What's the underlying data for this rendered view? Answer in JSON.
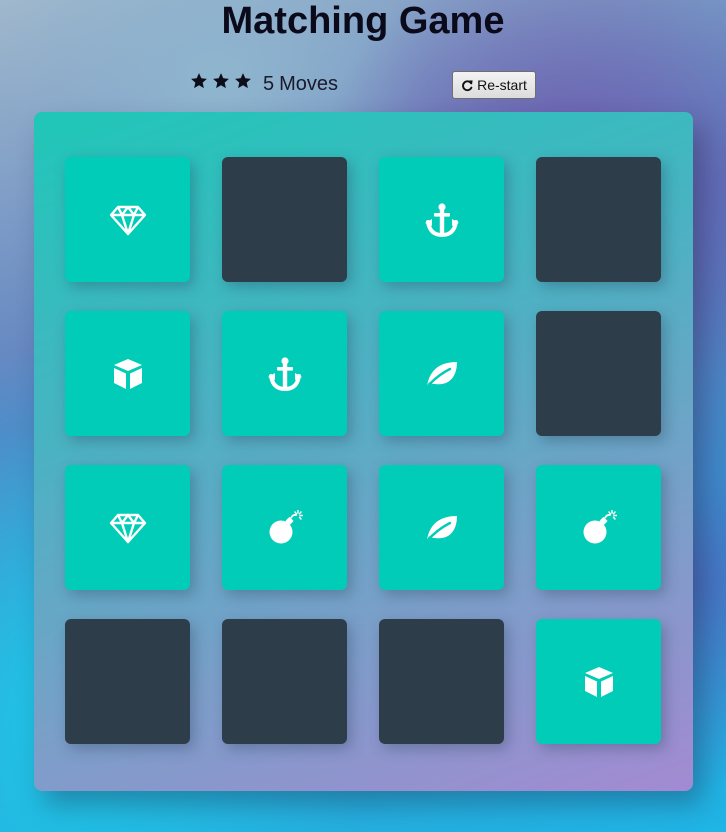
{
  "header": {
    "title": "Matching Game"
  },
  "score_panel": {
    "rating_stars": 3,
    "moves_count": "5",
    "moves_label": "Moves",
    "restart_label": "Re-start",
    "restart_icon": "repeat-icon"
  },
  "colors": {
    "card_face_down": "#2e3d4a",
    "card_face_up": "#01ccb7",
    "icon": "#ffffff",
    "deck_top": "#1fc7b8",
    "deck_bottom": "#a38ad2"
  },
  "deck": {
    "rows": [
      [
        {
          "state": "open",
          "icon": "diamond-icon"
        },
        {
          "state": "closed",
          "icon": ""
        },
        {
          "state": "open",
          "icon": "anchor-icon"
        },
        {
          "state": "closed",
          "icon": ""
        }
      ],
      [
        {
          "state": "open",
          "icon": "cube-icon"
        },
        {
          "state": "open",
          "icon": "anchor-icon"
        },
        {
          "state": "open",
          "icon": "leaf-icon"
        },
        {
          "state": "closed",
          "icon": ""
        }
      ],
      [
        {
          "state": "open",
          "icon": "diamond-icon"
        },
        {
          "state": "open",
          "icon": "bomb-icon"
        },
        {
          "state": "open",
          "icon": "leaf-icon"
        },
        {
          "state": "open",
          "icon": "bomb-icon"
        }
      ],
      [
        {
          "state": "closed",
          "icon": ""
        },
        {
          "state": "closed",
          "icon": ""
        },
        {
          "state": "closed",
          "icon": ""
        },
        {
          "state": "open",
          "icon": "cube-icon"
        }
      ]
    ]
  }
}
